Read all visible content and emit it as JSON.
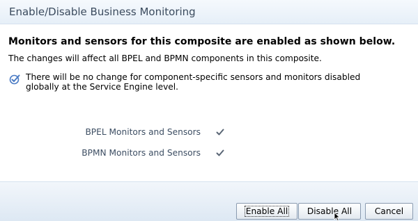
{
  "dialog": {
    "title": "Enable/Disable Business Monitoring"
  },
  "content": {
    "heading": "Monitors and sensors for this composite are enabled as shown below.",
    "subtext": "The changes will affect all BPEL and BPMN components in this composite.",
    "note": {
      "icon": "info-check-icon",
      "text": "There will be no change for component-specific sensors and monitors disabled globally at the Service Engine level."
    },
    "settings": [
      {
        "label": "BPEL Monitors and Sensors",
        "enabled": true,
        "icon": "checkmark-icon"
      },
      {
        "label": "BPMN Monitors and Sensors",
        "enabled": true,
        "icon": "checkmark-icon"
      }
    ]
  },
  "footer": {
    "enable_all_label": "Enable All",
    "disable_all_label": "Disable All",
    "cancel_label": "Cancel"
  },
  "colors": {
    "title_text": "#3b4b5e",
    "label_text": "#3d4e63",
    "icon_blue": "#4a7bc4",
    "check_gray": "#5a6675"
  }
}
